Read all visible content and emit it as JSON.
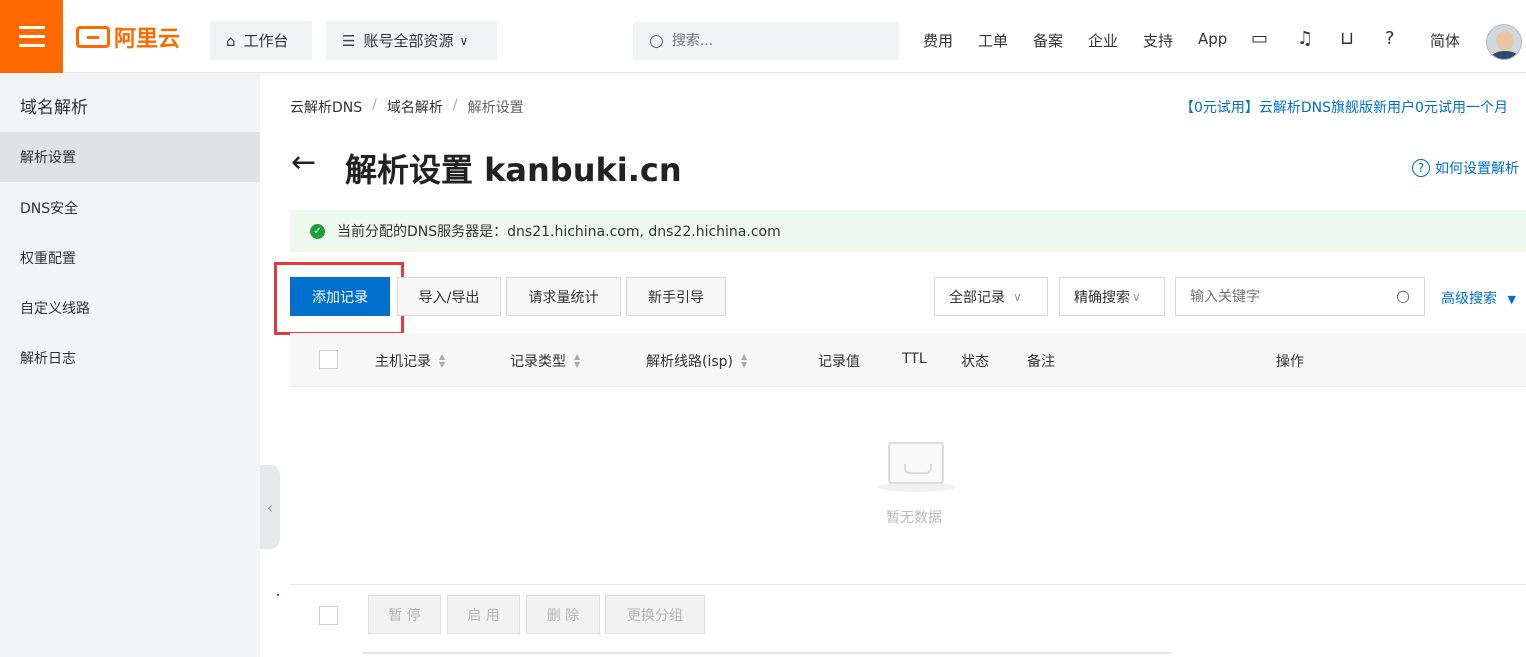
{
  "topbar": {
    "logo_text": "阿里云",
    "workbench": "工作台",
    "resources": "账号全部资源",
    "search_placeholder": "搜索...",
    "links": [
      "费用",
      "工单",
      "备案",
      "企业",
      "支持",
      "App"
    ],
    "lang": "简体",
    "brand_color": "#ff6a00"
  },
  "sidebar": {
    "title": "域名解析",
    "items": [
      {
        "label": "解析设置",
        "active": true
      },
      {
        "label": "DNS安全",
        "active": false
      },
      {
        "label": "权重配置",
        "active": false
      },
      {
        "label": "自定义线路",
        "active": false
      },
      {
        "label": "解析日志",
        "active": false
      }
    ]
  },
  "breadcrumb": {
    "items": [
      "云解析DNS",
      "域名解析",
      "解析设置"
    ],
    "sep": "/"
  },
  "promo": "【0元试用】云解析DNS旗舰版新用户0元试用一个月",
  "page": {
    "back": "←",
    "title": "解析设置 kanbuki.cn",
    "help": "如何设置解析"
  },
  "notice": {
    "text": "当前分配的DNS服务器是：dns21.hichina.com, dns22.hichina.com",
    "color": "#edf9ee"
  },
  "toolbar": {
    "add": "添加记录",
    "import_export": "导入/导出",
    "stats": "请求量统计",
    "guide": "新手引导",
    "filter_all": "全部记录",
    "exact_search": "精确搜索",
    "keyword_placeholder": "输入关键字",
    "advanced": "高级搜索",
    "primary_color": "#0070cc"
  },
  "table": {
    "columns": [
      "主机记录",
      "记录类型",
      "解析线路(isp)",
      "记录值",
      "TTL",
      "状态",
      "备注",
      "操作"
    ],
    "empty_text": "暂无数据"
  },
  "bulk": {
    "pause": "暂 停",
    "enable": "启 用",
    "delete": "删 除",
    "change_group": "更换分组"
  }
}
